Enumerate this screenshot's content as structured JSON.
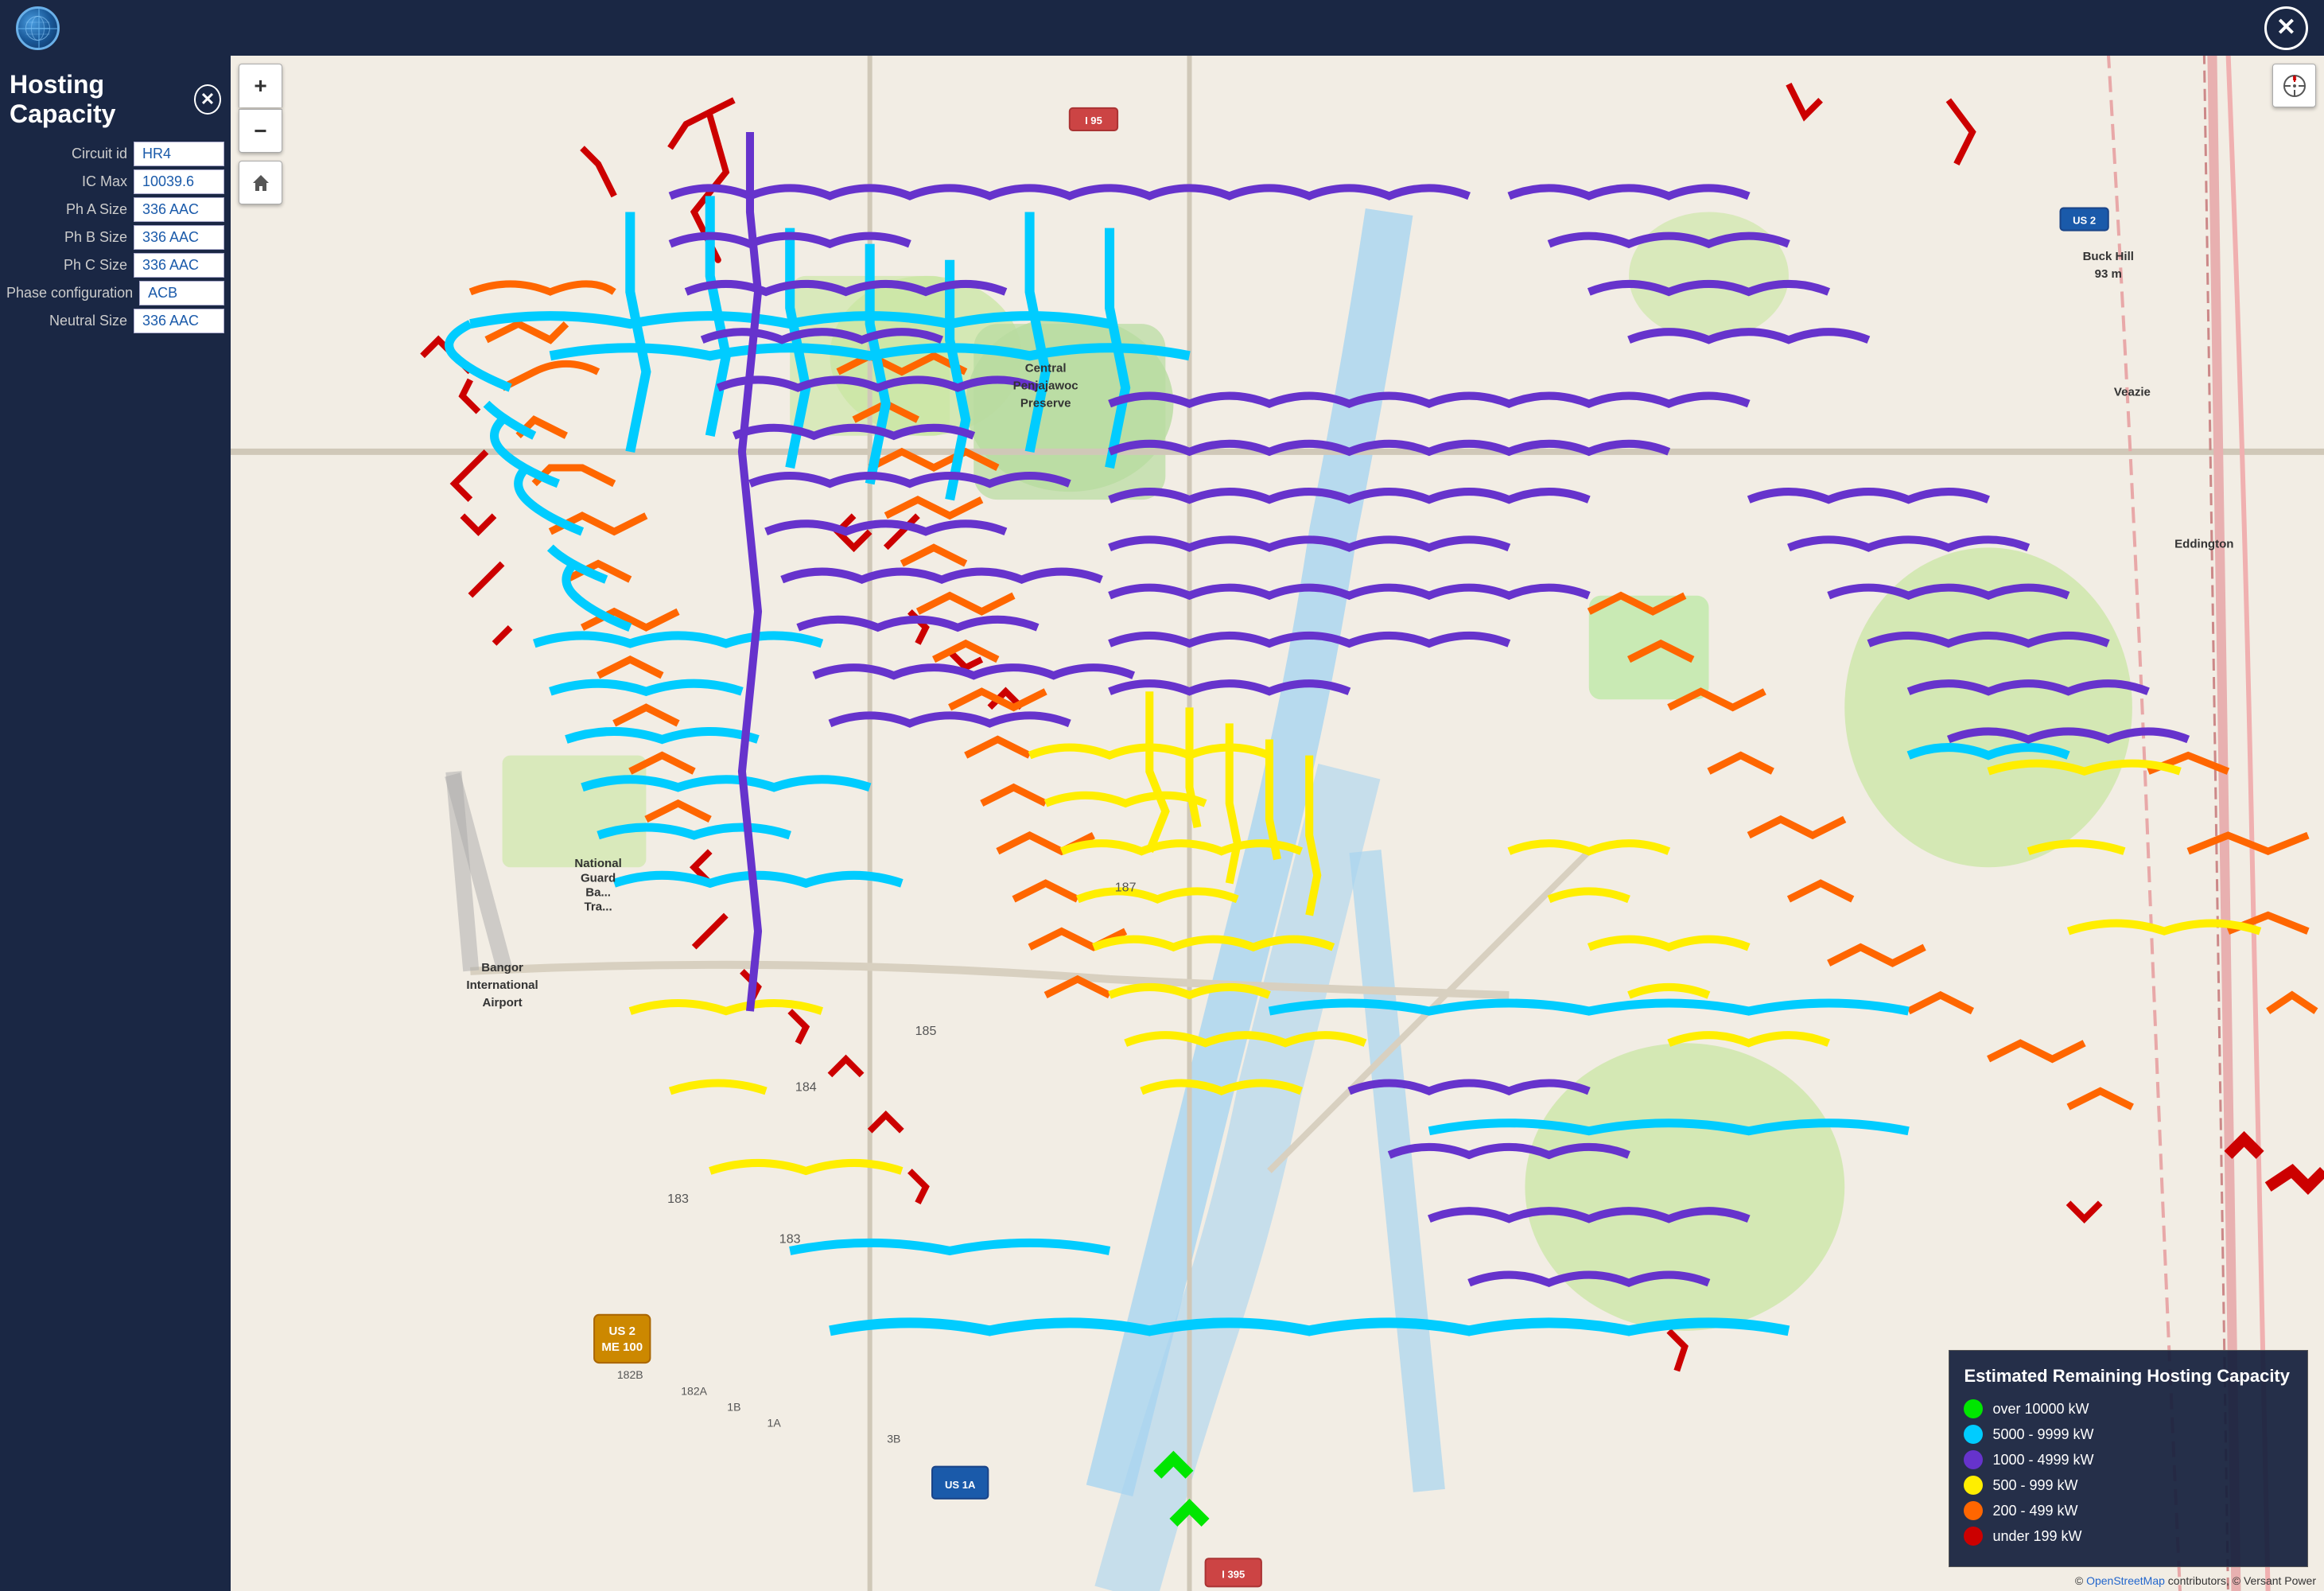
{
  "topbar": {
    "globe_alt": "Globe icon",
    "close_label": "✕"
  },
  "panel": {
    "title": "Hosting Capacity",
    "close_label": "✕",
    "fields": {
      "circuit_id_label": "Circuit id",
      "circuit_id_value": "HR4",
      "ic_max_label": "IC Max",
      "ic_max_value": "10039.6",
      "ph_a_size_label": "Ph A Size",
      "ph_a_size_value": "336 AAC",
      "ph_b_size_label": "Ph B Size",
      "ph_b_size_value": "336 AAC",
      "ph_c_size_label": "Ph C Size",
      "ph_c_size_value": "336 AAC",
      "phase_config_label": "Phase configuration",
      "phase_config_value": "ACB",
      "neutral_size_label": "Neutral Size",
      "neutral_size_value": "336 AAC"
    }
  },
  "map_controls": {
    "zoom_in_label": "+",
    "zoom_out_label": "−",
    "home_label": "⌂",
    "compass_label": "⊕"
  },
  "legend": {
    "title": "Estimated Remaining Hosting Capacity",
    "items": [
      {
        "color": "#00e600",
        "label": "over 10000 kW"
      },
      {
        "color": "#00ccff",
        "label": "5000 - 9999 kW"
      },
      {
        "color": "#6633cc",
        "label": "1000 - 4999 kW"
      },
      {
        "color": "#ffee00",
        "label": "500 - 999 kW"
      },
      {
        "color": "#ff6600",
        "label": "200 - 499 kW"
      },
      {
        "color": "#cc0000",
        "label": "under 199 kW"
      }
    ]
  },
  "attribution": {
    "prefix": "© ",
    "osm_label": "OpenStreetMap",
    "osm_url": "#",
    "suffix": " contributors, © Versant Power"
  },
  "map_places": {
    "central_penjawoc": "Central\nPenjajawoc\nPreserve",
    "national_guard": "National\nGuard\nBa...\nTra...",
    "bangor_airport": "Bangor\nInternational\nAirport",
    "veazie": "Veazie",
    "eddington": "Eddington",
    "buck_hill": "Buck Hill\n93 m"
  },
  "road_labels": {
    "i95_north": "I 95",
    "us2": "US 2",
    "us2_me100": "US 2\nME 100",
    "us1a": "US 1A",
    "i395": "I 395",
    "r183": "183",
    "r184": "184",
    "r185": "185",
    "r187": "187",
    "r182b": "182B",
    "r182a": "182A",
    "r182b2": "182B",
    "r1b": "1B",
    "r1a": "1A",
    "r3b": "3B"
  }
}
